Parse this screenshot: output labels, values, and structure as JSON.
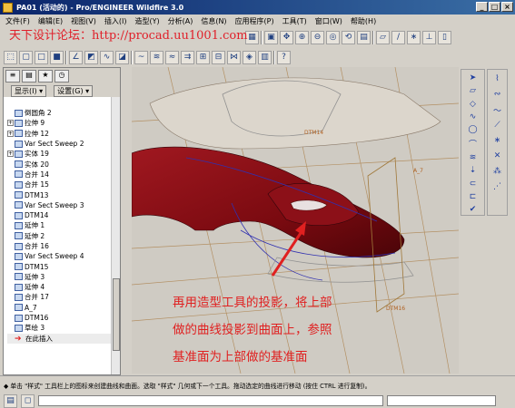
{
  "window": {
    "title": "PA01 (活动的) - Pro/ENGINEER Wildfire 3.0"
  },
  "menu": [
    "文件(F)",
    "编辑(E)",
    "视图(V)",
    "插入(I)",
    "造型(Y)",
    "分析(A)",
    "信息(N)",
    "应用程序(P)",
    "工具(T)",
    "窗口(W)",
    "帮助(H)"
  ],
  "watermark": "天下设计论坛：http://procad.uu1001.com",
  "panel": {
    "show_label": "显示(I) ▾",
    "settings_label": "设置(G) ▾"
  },
  "tree": [
    {
      "label": "倒圆角 2",
      "exp": ""
    },
    {
      "label": "拉伸 9",
      "exp": "+"
    },
    {
      "label": "拉伸 12",
      "exp": "+"
    },
    {
      "label": "Var Sect Sweep 2",
      "exp": ""
    },
    {
      "label": "实体 19",
      "exp": "+"
    },
    {
      "label": "实体 20",
      "exp": ""
    },
    {
      "label": "合并 14",
      "exp": ""
    },
    {
      "label": "合并 15",
      "exp": ""
    },
    {
      "label": "DTM13",
      "exp": ""
    },
    {
      "label": "Var Sect Sweep 3",
      "exp": ""
    },
    {
      "label": "DTM14",
      "exp": ""
    },
    {
      "label": "延伸 1",
      "exp": ""
    },
    {
      "label": "延伸 2",
      "exp": ""
    },
    {
      "label": "合并 16",
      "exp": ""
    },
    {
      "label": "Var Sect Sweep 4",
      "exp": ""
    },
    {
      "label": "DTM15",
      "exp": ""
    },
    {
      "label": "延伸 3",
      "exp": ""
    },
    {
      "label": "延伸 4",
      "exp": ""
    },
    {
      "label": "合并 17",
      "exp": ""
    },
    {
      "label": "A_7",
      "exp": ""
    },
    {
      "label": "DTM16",
      "exp": ""
    },
    {
      "label": "草绘 3",
      "exp": ""
    },
    {
      "label": "在此插入",
      "exp": "",
      "insert": true
    }
  ],
  "annotation": [
    "再用造型工具的投影，将上部",
    "做的曲线投影到曲面上，参照",
    "基准面为上部做的基准面"
  ],
  "status": "◆ 单击 \"样式\" 工具栏上的图标来创建曲线和曲面。选取 \"样式\" 几何或下一个工具。拖动选定的曲线进行移动 (按住 CTRL 进行复制)。",
  "viewport_labels": [
    "DTM14",
    "A_7",
    "DTM16"
  ],
  "colors": {
    "body": "#7a0a10",
    "title_start": "#0a246a",
    "annotation": "#e02020"
  }
}
